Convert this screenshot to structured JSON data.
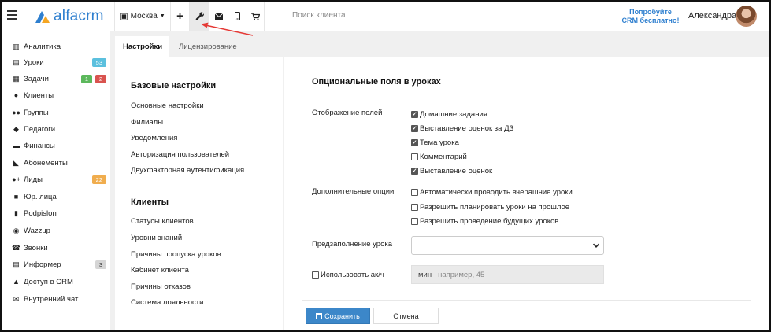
{
  "header": {
    "logo_text": "alfacrm",
    "city": "Москва",
    "search_placeholder": "Поиск клиента",
    "promo_line1": "Попробуйте",
    "promo_line2": "CRM бесплатно!",
    "user_name": "Александра"
  },
  "sidebar": {
    "items": [
      {
        "label": "Аналитика",
        "icon": "book-icon"
      },
      {
        "label": "Уроки",
        "icon": "calendar-icon",
        "badges": [
          {
            "text": "53",
            "color": "#5bc0de"
          }
        ]
      },
      {
        "label": "Задачи",
        "icon": "tasks-icon",
        "badges": [
          {
            "text": "1",
            "color": "#5cb85c"
          },
          {
            "text": "2",
            "color": "#d9534f"
          }
        ]
      },
      {
        "label": "Клиенты",
        "icon": "user-icon"
      },
      {
        "label": "Группы",
        "icon": "users-icon"
      },
      {
        "label": "Педагоги",
        "icon": "graduation-cap-icon"
      },
      {
        "label": "Финансы",
        "icon": "money-icon"
      },
      {
        "label": "Абонементы",
        "icon": "tag-icon"
      },
      {
        "label": "Лиды",
        "icon": "user-plus-icon",
        "badges": [
          {
            "text": "22",
            "color": "#f0ad4e"
          }
        ]
      },
      {
        "label": "Юр. лица",
        "icon": "briefcase-icon"
      },
      {
        "label": "Podpislon",
        "icon": "file-icon"
      },
      {
        "label": "Wazzup",
        "icon": "whatsapp-icon"
      },
      {
        "label": "Звонки",
        "icon": "phone-icon"
      },
      {
        "label": "Информер",
        "icon": "newspaper-icon",
        "badges": [
          {
            "text": "3",
            "color": "#d5d5d5",
            "text_color": "#333"
          }
        ]
      },
      {
        "label": "Доступ в CRM",
        "icon": "lock-icon"
      },
      {
        "label": "Внутренний чат",
        "icon": "envelope-icon"
      }
    ]
  },
  "tabs": [
    {
      "label": "Настройки",
      "active": true
    },
    {
      "label": "Лицензирование",
      "active": false
    }
  ],
  "settings_menu": {
    "basic_title": "Базовые настройки",
    "basic_items": [
      "Основные настройки",
      "Филиалы",
      "Уведомления",
      "Авторизация пользователей",
      "Двухфакторная аутентификация"
    ],
    "clients_title": "Клиенты",
    "clients_items": [
      "Статусы клиентов",
      "Уровни знаний",
      "Причины пропуска уроков",
      "Кабинет клиента",
      "Причины отказов",
      "Система лояльности"
    ]
  },
  "main": {
    "title": "Опциональные поля в уроках",
    "display_label": "Отображение полей",
    "display_options": [
      {
        "label": "Домашние задания",
        "checked": true
      },
      {
        "label": "Выставление оценок за ДЗ",
        "checked": true
      },
      {
        "label": "Тема урока",
        "checked": true
      },
      {
        "label": "Комментарий",
        "checked": false
      },
      {
        "label": "Выставление оценок",
        "checked": true
      }
    ],
    "extra_label": "Дополнительные опции",
    "extra_options": [
      {
        "label": "Автоматически проводить вчерашние уроки",
        "checked": false
      },
      {
        "label": "Разрешить планировать уроки на прошлое",
        "checked": false
      },
      {
        "label": "Разрешить проведение будущих уроков",
        "checked": false
      }
    ],
    "prefill_label": "Предзаполнение урока",
    "prefill_value": "",
    "use_ak_label": "Использовать ак/ч",
    "use_ak_checked": false,
    "minutes_unit": "мин",
    "minutes_placeholder": "например, 45",
    "save_label": "Сохранить",
    "cancel_label": "Отмена"
  },
  "colors": {
    "brand": "#2e7fcf",
    "save_button": "#3c87c9",
    "annotation_arrow": "#e53935"
  }
}
